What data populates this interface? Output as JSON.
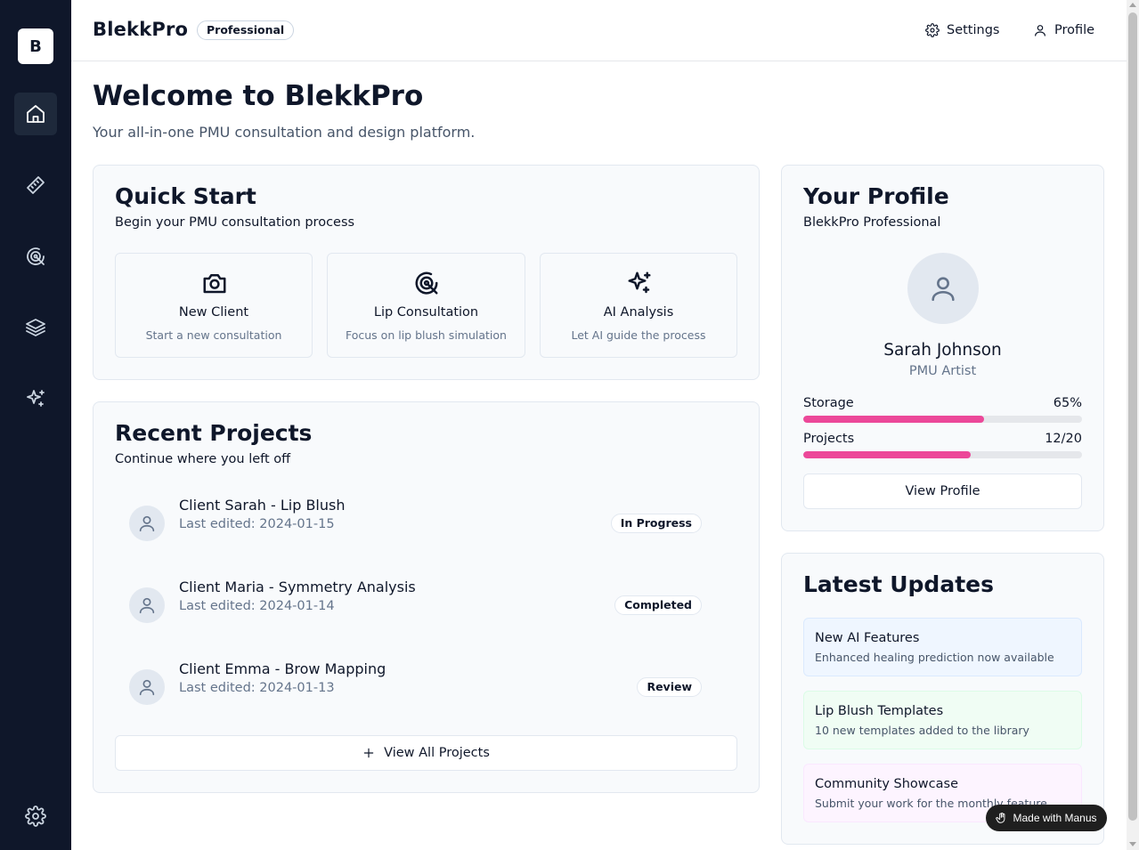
{
  "sidebar": {
    "logo_letter": "B",
    "items": [
      {
        "icon": "home-icon",
        "active": true
      },
      {
        "icon": "ruler-icon"
      },
      {
        "icon": "target-icon"
      },
      {
        "icon": "layers-icon"
      },
      {
        "icon": "sparkles-icon"
      }
    ],
    "settings_icon": "gear-icon"
  },
  "header": {
    "app_name": "BlekkPro",
    "plan_badge": "Professional",
    "settings_label": "Settings",
    "profile_label": "Profile"
  },
  "welcome": {
    "title": "Welcome to BlekkPro",
    "subtitle": "Your all-in-one PMU consultation and design platform."
  },
  "quick_start": {
    "title": "Quick Start",
    "subtitle": "Begin your PMU consultation process",
    "tiles": [
      {
        "icon": "camera-icon",
        "label": "New Client",
        "desc": "Start a new consultation"
      },
      {
        "icon": "target-icon",
        "label": "Lip Consultation",
        "desc": "Focus on lip blush simulation"
      },
      {
        "icon": "sparkles-icon",
        "label": "AI Analysis",
        "desc": "Let AI guide the process"
      }
    ]
  },
  "recent_projects": {
    "title": "Recent Projects",
    "subtitle": "Continue where you left off",
    "items": [
      {
        "name": "Client Sarah - Lip Blush",
        "date": "Last edited: 2024-01-15",
        "status": "In Progress"
      },
      {
        "name": "Client Maria - Symmetry Analysis",
        "date": "Last edited: 2024-01-14",
        "status": "Completed"
      },
      {
        "name": "Client Emma - Brow Mapping",
        "date": "Last edited: 2024-01-13",
        "status": "Review"
      }
    ],
    "view_all_label": "View All Projects"
  },
  "profile": {
    "title": "Your Profile",
    "subtitle": "BlekkPro Professional",
    "name": "Sarah Johnson",
    "role": "PMU Artist",
    "storage_label": "Storage",
    "storage_value": "65%",
    "storage_fraction": 0.65,
    "projects_label": "Projects",
    "projects_value": "12/20",
    "projects_fraction": 0.6,
    "view_profile_label": "View Profile"
  },
  "updates": {
    "title": "Latest Updates",
    "items": [
      {
        "title": "New AI Features",
        "desc": "Enhanced healing prediction now available",
        "bg": "#eff6ff",
        "border": "#dbeafe"
      },
      {
        "title": "Lip Blush Templates",
        "desc": "10 new templates added to the library",
        "bg": "#f0fdf4",
        "border": "#dcfce7"
      },
      {
        "title": "Community Showcase",
        "desc": "Submit your work for the monthly feature",
        "bg": "#fdf4ff",
        "border": "#fae8ff"
      }
    ]
  },
  "made_with": "Made with Manus",
  "colors": {
    "sidebar_bg": "#0f172a",
    "accent": "#ec4899"
  }
}
